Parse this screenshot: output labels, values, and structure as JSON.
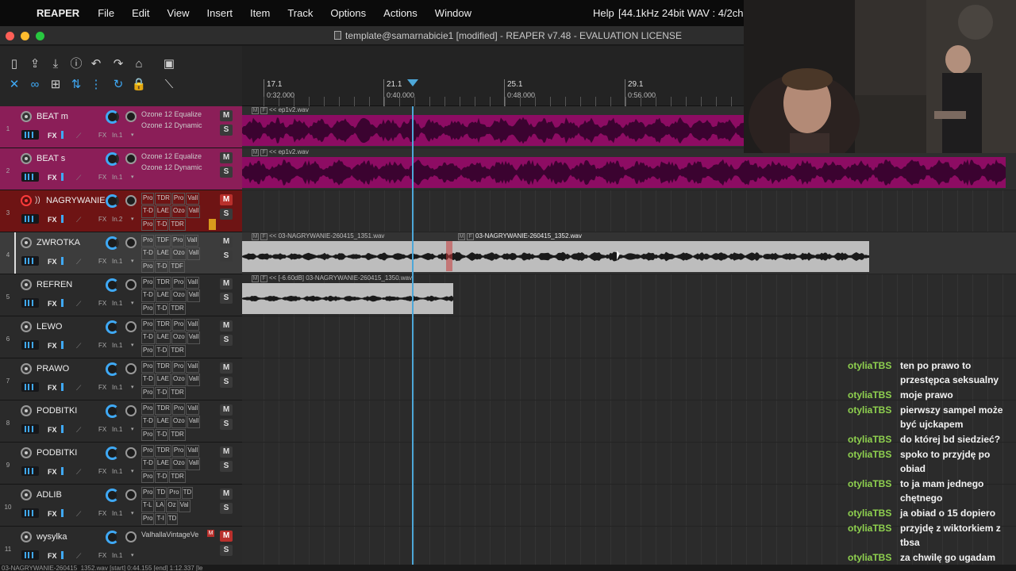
{
  "menubar": {
    "app": "REAPER",
    "items": [
      "File",
      "Edit",
      "View",
      "Insert",
      "Item",
      "Track",
      "Options",
      "Actions",
      "Window"
    ],
    "help": "Help",
    "status": "[44.1kHz 24bit WAV : 4/2ch 51"
  },
  "window": {
    "title": "template@samarnabicie1 [modified] - REAPER v7.48 - EVALUATION LICENSE"
  },
  "ruler": {
    "marks": [
      {
        "bar": "17.1",
        "time": "0:32.000"
      },
      {
        "bar": "21.1",
        "time": "0:40.000"
      },
      {
        "bar": "25.1",
        "time": "0:48.000"
      },
      {
        "bar": "29.1",
        "time": "0:56.000"
      }
    ]
  },
  "tracks": [
    {
      "num": "1",
      "name": "BEAT m",
      "fx": [
        "Ozone 12 Equalize",
        "Ozone 12 Dynamic"
      ],
      "io": "In.1",
      "route": "FX",
      "m": "M",
      "s": "S"
    },
    {
      "num": "2",
      "name": "BEAT s",
      "fx": [
        "Ozone 12 Equalize",
        "Ozone 12 Dynamic"
      ],
      "io": "In.1",
      "route": "FX",
      "m": "M",
      "s": "S"
    },
    {
      "num": "3",
      "name": "NAGRYWANIE",
      "fxgrid": [
        "Pro",
        "TDR",
        "Pro",
        "Vall",
        "T-D",
        "LAE",
        "Ozo",
        "Vall",
        "Pro",
        "T-D",
        "TDR"
      ],
      "io": "In.2",
      "route": "FX",
      "m": "M",
      "s": "S"
    },
    {
      "num": "4",
      "name": "ZWROTKA",
      "fxgrid": [
        "Pro",
        "TDF",
        "Pro",
        "Vall",
        "T-D",
        "LAE",
        "Ozo",
        "Vall",
        "Pro",
        "T-D",
        "TDF"
      ],
      "io": "In.1",
      "route": "FX",
      "m": "M",
      "s": "S"
    },
    {
      "num": "5",
      "name": "REFREN",
      "fxgrid": [
        "Pro",
        "TDR",
        "Pro",
        "Vall",
        "T-D",
        "LAE",
        "Ozo",
        "Vall",
        "Pro",
        "T-D",
        "TDR"
      ],
      "io": "In.1",
      "route": "FX",
      "m": "M",
      "s": "S"
    },
    {
      "num": "6",
      "name": "LEWO",
      "fxgrid": [
        "Pro",
        "TDR",
        "Pro",
        "Vall",
        "T-D",
        "LAE",
        "Ozo",
        "Vall",
        "Pro",
        "T-D",
        "TDR"
      ],
      "io": "In.1",
      "route": "FX",
      "m": "M",
      "s": "S"
    },
    {
      "num": "7",
      "name": "PRAWO",
      "fxgrid": [
        "Pro",
        "TDR",
        "Pro",
        "Vall",
        "T-D",
        "LAE",
        "Ozo",
        "Vall",
        "Pro",
        "T-D",
        "TDR"
      ],
      "io": "In.1",
      "route": "FX",
      "m": "M",
      "s": "S"
    },
    {
      "num": "8",
      "name": "PODBITKI",
      "fxgrid": [
        "Pro",
        "TDR",
        "Pro",
        "Vall",
        "T-D",
        "LAE",
        "Ozo",
        "Vall",
        "Pro",
        "T-D",
        "TDR"
      ],
      "io": "In.1",
      "route": "FX",
      "m": "M",
      "s": "S"
    },
    {
      "num": "9",
      "name": "PODBITKI",
      "fxgrid": [
        "Pro",
        "TDR",
        "Pro",
        "Vall",
        "T-D",
        "LAE",
        "Ozo",
        "Vall",
        "Pro",
        "T-D",
        "TDR"
      ],
      "io": "In.1",
      "route": "FX",
      "m": "M",
      "s": "S"
    },
    {
      "num": "10",
      "name": "ADLIB",
      "fxgrid": [
        "Pro",
        "TD",
        "Pro",
        "TD",
        "T-L",
        "LA",
        "Oz",
        "Val",
        "Pro",
        "T-I",
        "TD"
      ],
      "io": "In.1",
      "route": "FX",
      "m": "M",
      "s": "S"
    },
    {
      "num": "11",
      "name": "wysylka",
      "fx": [
        "ValhallaVintageVe"
      ],
      "io": "In.1",
      "route": "FX",
      "m": "M",
      "s": "S"
    }
  ],
  "items": {
    "beat1": "<< ep1v2.wav",
    "beat2": "<< ep1v2.wav",
    "vox1": "<< 03-NAGRYWANIE-260415_1351.wav",
    "vox2": "03-NAGRYWANIE-260415_1352.wav",
    "vox3": "<< [-6.60dB] 03-NAGRYWANIE-260415_1350.wav"
  },
  "chat": [
    {
      "user": "otyliaTBS",
      "text": "ten po prawo to przestępca seksualny"
    },
    {
      "user": "otyliaTBS",
      "text": "moje prawo"
    },
    {
      "user": "otyliaTBS",
      "text": "pierwszy sampel może być ujckapem"
    },
    {
      "user": "otyliaTBS",
      "text": "do której bd siedzieć?"
    },
    {
      "user": "otyliaTBS",
      "text": "spoko to przyjdę po obiad"
    },
    {
      "user": "otyliaTBS",
      "text": "to ja mam jednego chętnego"
    },
    {
      "user": "otyliaTBS",
      "text": "ja obiad o 15 dopiero"
    },
    {
      "user": "otyliaTBS",
      "text": "przyjdę z wiktorkiem z tbsa"
    },
    {
      "user": "otyliaTBS",
      "text": "za chwilę go ugadam"
    }
  ],
  "statusbar": "03-NAGRYWANIE-260415_1352.wav [start] 0:44.155 [end] 1:12.337 [le",
  "colors": {
    "beat": "#8d0c63",
    "armed": "#6e1414",
    "accent": "#3fa9f5",
    "cursor": "#4da7d8",
    "chat_user": "#8fd14f"
  },
  "icons": [
    "apple-icon",
    "new-project-icon",
    "save-icon",
    "info-icon",
    "undo-icon",
    "redo-icon",
    "metronome-icon",
    "grid-icon",
    "ripple-icon",
    "snap-icon",
    "lock-icon"
  ]
}
